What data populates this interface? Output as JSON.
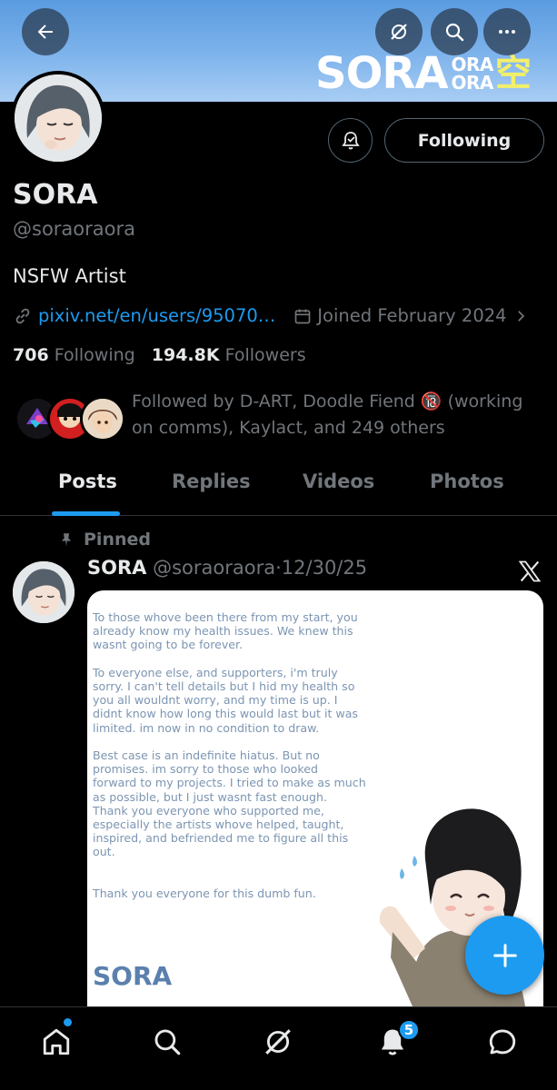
{
  "header": {
    "logo_main": "SORA",
    "logo_small_top": "ORA",
    "logo_small_bottom": "ORA",
    "logo_kanji": "空",
    "banner_color": "#7fb4ec"
  },
  "profile": {
    "name": "SORA",
    "handle": "@soraoraora",
    "bio": "NSFW Artist",
    "link": "pixiv.net/en/users/95070…",
    "joined": "Joined February 2024",
    "following_count": "706",
    "following_label": "Following",
    "followers_count": "194.8K",
    "followers_label": "Followers",
    "followed_by": "Followed by D-ART, Doodle Fiend 🔞 (working on comms), Kaylact, and 249 others",
    "follow_button": "Following"
  },
  "tabs": [
    {
      "label": "Posts",
      "active": true
    },
    {
      "label": "Replies",
      "active": false
    },
    {
      "label": "Videos",
      "active": false
    },
    {
      "label": "Photos",
      "active": false
    }
  ],
  "post": {
    "pinned_label": "Pinned",
    "author": "SORA",
    "handle": "@soraoraora",
    "separator": "·",
    "date": "12/30/25",
    "image_text": "To those whove been there from my start, you\nalready know my health issues. We knew this\nwasnt going to be forever.\n\nTo everyone else, and supporters, i'm truly\nsorry. I can't tell details but I hid my health so\nyou all wouldnt worry, and my time is up. I\ndidnt know how long this would last but it was\nlimited. im now in no condition to draw.\n\nBest case is an indefinite hiatus. But no\npromises. im sorry to those who looked\nforward to my projects. I tried to make as much\nas possible, but I just wasnt fast enough.\nThank you everyone who supported me,\nespecially the artists whove helped, taught,\ninspired, and befriended me to figure all this\nout.\n\n\nThank you everyone for this dumb fun.",
    "image_signature": "SORA"
  },
  "bottom_nav": {
    "items": [
      "home-icon",
      "search-icon",
      "grok-icon",
      "notifications-icon",
      "messages-icon"
    ],
    "notification_count": "5"
  },
  "colors": {
    "accent": "#1d9bf0",
    "text_primary": "#e7e9ea",
    "text_secondary": "#71767b"
  }
}
